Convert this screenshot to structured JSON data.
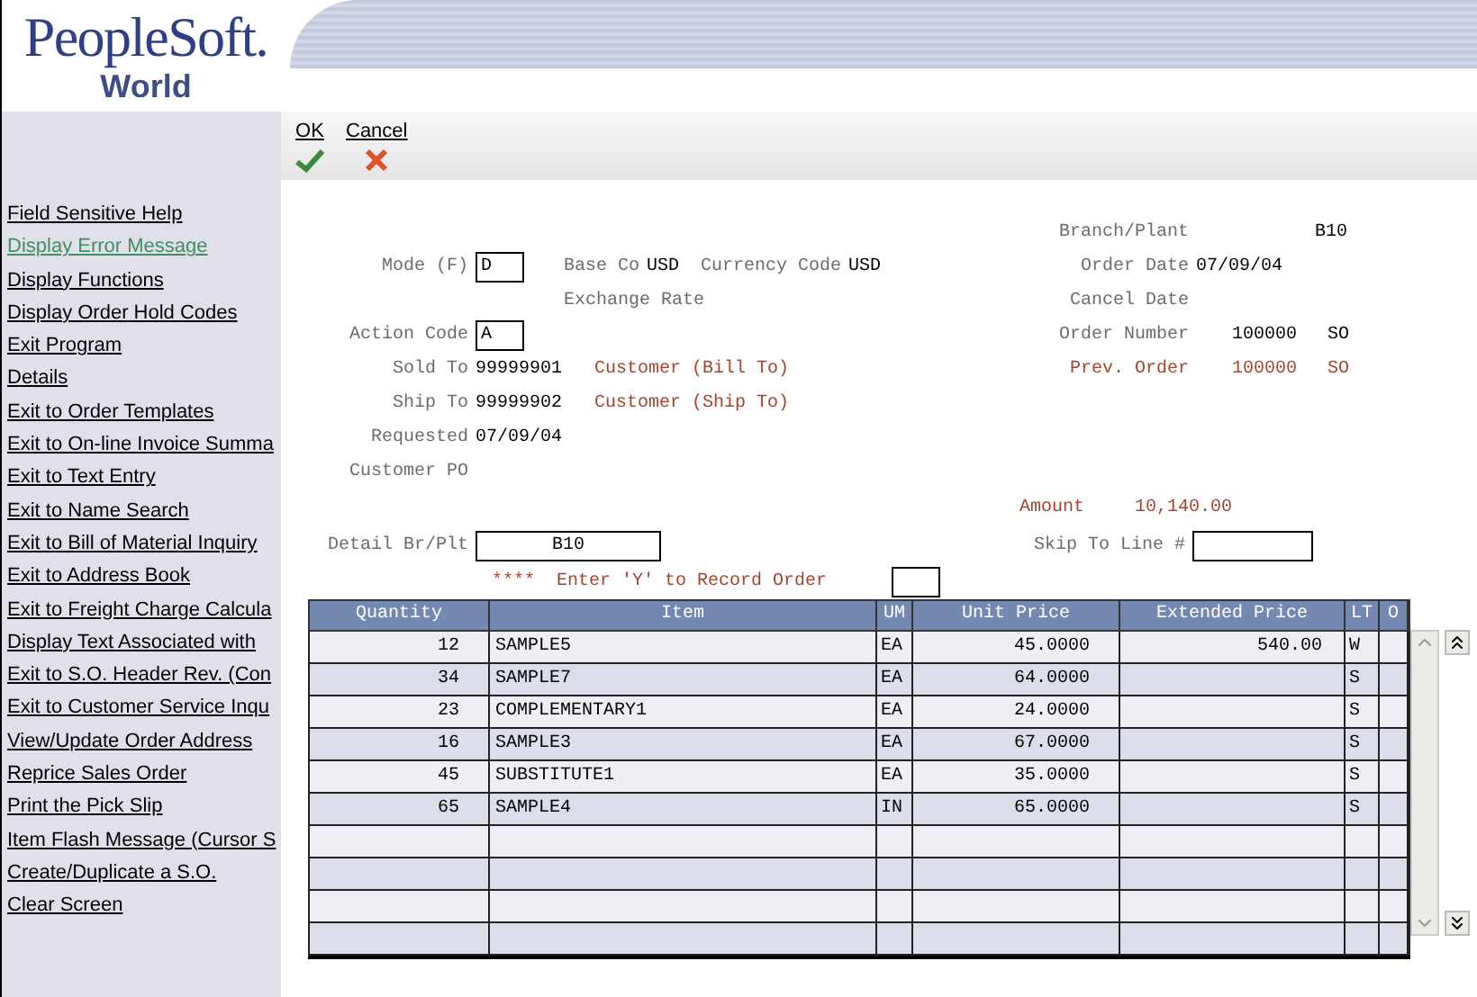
{
  "logo": {
    "name": "PeopleSoft.",
    "product": "World"
  },
  "menu": [
    {
      "label": "Field Sensitive Help",
      "selected": false
    },
    {
      "label": "Display Error Message",
      "selected": true
    },
    {
      "label": "Display Functions",
      "selected": false
    },
    {
      "label": "Display Order Hold Codes",
      "selected": false
    },
    {
      "label": "Exit Program",
      "selected": false
    },
    {
      "label": "Details",
      "selected": false
    },
    {
      "label": "Exit to Order Templates",
      "selected": false
    },
    {
      "label": "Exit to On-line Invoice Summa",
      "selected": false
    },
    {
      "label": "Exit to Text Entry",
      "selected": false
    },
    {
      "label": "Exit to Name Search",
      "selected": false
    },
    {
      "label": "Exit to Bill of Material Inquiry",
      "selected": false
    },
    {
      "label": "Exit to Address Book",
      "selected": false
    },
    {
      "label": "Exit to Freight Charge Calcula",
      "selected": false
    },
    {
      "label": "Display Text Associated with",
      "selected": false
    },
    {
      "label": "Exit to S.O. Header Rev. (Con",
      "selected": false
    },
    {
      "label": "Exit to Customer Service Inqu",
      "selected": false
    },
    {
      "label": "View/Update Order Address",
      "selected": false
    },
    {
      "label": "Reprice Sales Order",
      "selected": false
    },
    {
      "label": "Print the Pick Slip",
      "selected": false
    },
    {
      "label": "Item Flash Message (Cursor S",
      "selected": false
    },
    {
      "label": "Create/Duplicate a S.O.",
      "selected": false
    },
    {
      "label": "Clear Screen",
      "selected": false
    }
  ],
  "toolbar": [
    {
      "label": "OK",
      "kind": "ok"
    },
    {
      "label": "Cancel",
      "kind": "cancel"
    }
  ],
  "form": {
    "mode": {
      "label": "Mode (F)",
      "value": "D"
    },
    "base_co": {
      "label": "Base Co",
      "value": "USD"
    },
    "currency_code": {
      "label": "Currency Code",
      "value": "USD"
    },
    "exchange_rate": {
      "label": "Exchange Rate"
    },
    "action_code": {
      "label": "Action Code",
      "value": "A"
    },
    "sold_to": {
      "label": "Sold To",
      "value": "99999901",
      "description": "Customer (Bill To)"
    },
    "ship_to": {
      "label": "Ship To",
      "value": "99999902",
      "description": "Customer (Ship To)"
    },
    "requested": {
      "label": "Requested",
      "value": "07/09/04"
    },
    "customer_po": {
      "label": "Customer PO"
    },
    "branch_plant": {
      "label": "Branch/Plant",
      "value": "B10"
    },
    "order_date": {
      "label": "Order Date",
      "value": "07/09/04"
    },
    "cancel_date": {
      "label": "Cancel Date"
    },
    "order_number": {
      "label": "Order Number",
      "value": "100000",
      "type": "SO"
    },
    "prev_order": {
      "label": "Prev. Order",
      "value": "100000",
      "type": "SO"
    },
    "amount": {
      "label": "Amount",
      "value": "10,140.00"
    },
    "detail_br_plt": {
      "label": "Detail Br/Plt",
      "value": "B10"
    },
    "skip_to_line": {
      "label": "Skip To Line #"
    },
    "record_prompt": {
      "marker": "****",
      "text": "Enter 'Y' to Record Order"
    }
  },
  "table": {
    "columns": [
      "Quantity",
      "Item",
      "UM",
      "Unit Price",
      "Extended Price",
      "LT",
      "O"
    ],
    "rows": [
      [
        "12",
        "SAMPLE5",
        "EA",
        "45.0000",
        "540.00",
        "W"
      ],
      [
        "34",
        "SAMPLE7",
        "EA",
        "64.0000",
        "",
        "S"
      ],
      [
        "23",
        "COMPLEMENTARY1",
        "EA",
        "24.0000",
        "",
        "S"
      ],
      [
        "16",
        "SAMPLE3",
        "EA",
        "67.0000",
        "",
        "S"
      ],
      [
        "45",
        "SUBSTITUTE1",
        "EA",
        "35.0000",
        "",
        "S"
      ],
      [
        "65",
        "SAMPLE4",
        "IN",
        "65.0000",
        "",
        "S"
      ]
    ]
  }
}
